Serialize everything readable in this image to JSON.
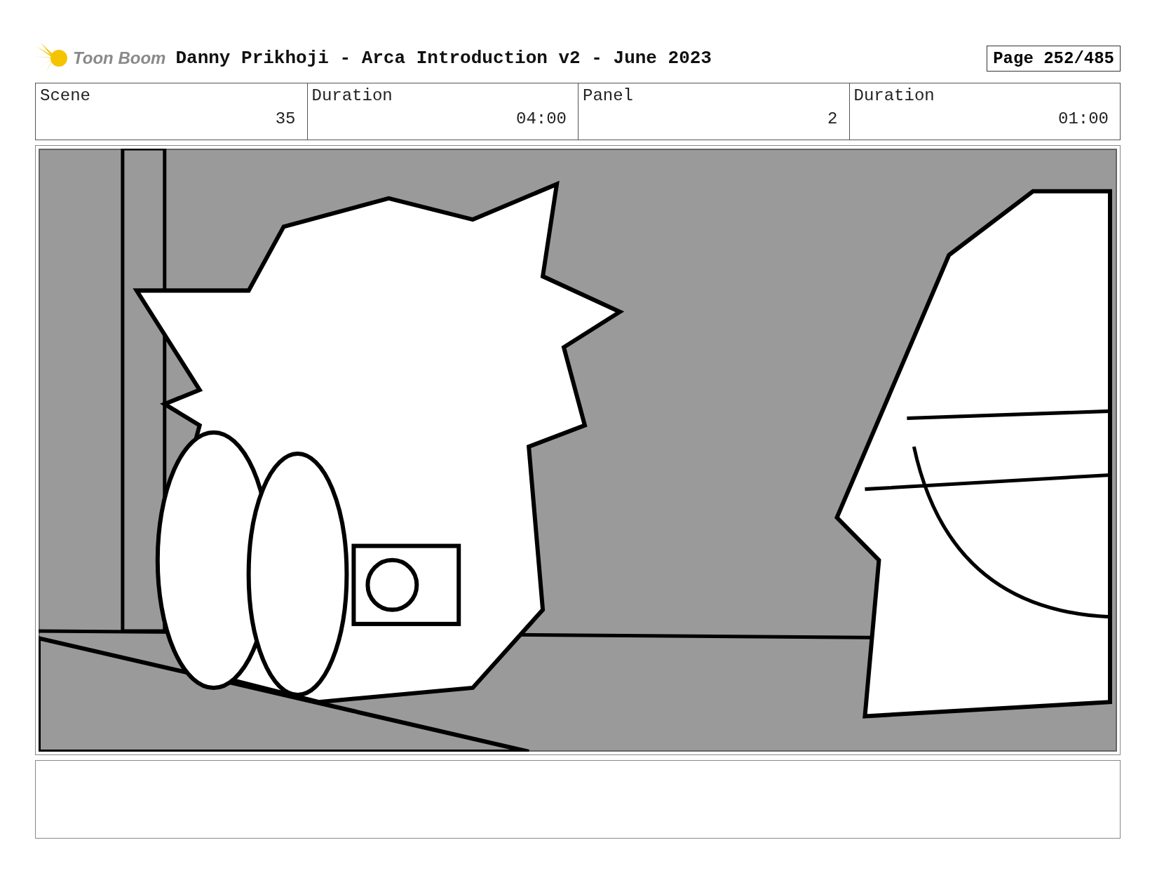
{
  "header": {
    "logo": "Toon Boom",
    "title": "Danny Prikhoji - Arca Introduction v2 - June 2023",
    "page": "Page 252/485"
  },
  "fields": [
    {
      "label": "Scene",
      "value": "35"
    },
    {
      "label": "Duration",
      "value": "04:00"
    },
    {
      "label": "Panel",
      "value": "2"
    },
    {
      "label": "Duration",
      "value": "01:00"
    }
  ]
}
